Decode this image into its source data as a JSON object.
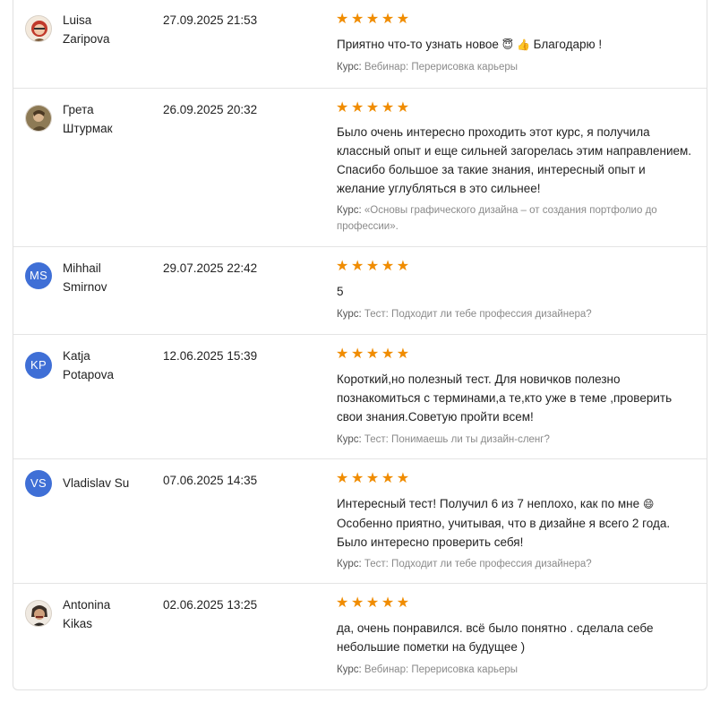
{
  "reviews": [
    {
      "name_line1": "Luisa",
      "name_line2": "Zaripova",
      "avatar_type": "photo",
      "avatar_icon": "user-photo-icon",
      "date": "27.09.2025 21:53",
      "stars": "★★★★★",
      "rating": 5,
      "text_before": "Приятно что-то узнать новое ",
      "text_after": " Благодарю !",
      "emoji_1": "😇",
      "emoji_2": "👍",
      "course_label": "Курс:",
      "course": "Вебинар: Перерисовка карьеры"
    },
    {
      "name_line1": "Грета",
      "name_line2": "Штурмак",
      "avatar_type": "photo",
      "avatar_icon": "user-photo-icon",
      "date": "26.09.2025 20:32",
      "stars": "★★★★★",
      "rating": 5,
      "text": "Было очень интересно проходить этот курс, я получила классный опыт и еще сильней загорелась этим направлением. Спасибо большое за такие знания, интересный опыт и желание углубляться в это сильнее!",
      "course_label": "Курс:",
      "course": "«Основы графического дизайна – от создания портфолио до профессии»."
    },
    {
      "name_line1": "Mihhail",
      "name_line2": "Smirnov",
      "avatar_type": "initials",
      "initials": "MS",
      "date": "29.07.2025 22:42",
      "stars": "★★★★★",
      "rating": 5,
      "text": "5",
      "course_label": "Курс:",
      "course": "Тест: Подходит ли тебе профессия дизайнера?"
    },
    {
      "name_line1": "Katja",
      "name_line2": "Potapova",
      "avatar_type": "initials",
      "initials": "KP",
      "date": "12.06.2025 15:39",
      "stars": "★★★★★",
      "rating": 5,
      "text": "Короткий,но полезный тест. Для новичков полезно познакомиться с терминами,а те,кто уже в теме ,проверить свои знания.Советую пройти всем!",
      "course_label": "Курс:",
      "course": "Тест: Понимаешь ли ты дизайн-сленг?"
    },
    {
      "name_line1": "Vladislav Su",
      "name_line2": "",
      "avatar_type": "initials",
      "initials": "VS",
      "date": "07.06.2025 14:35",
      "stars": "★★★★★",
      "rating": 5,
      "text_line1": "Интересный тест! Получил 6 из 7 неплохо, как по мне ",
      "emoji_1": "😄",
      "text_rest": "Особенно приятно, учитывая, что в дизайне я всего 2 года. Было интересно проверить себя!",
      "course_label": "Курс:",
      "course": "Тест: Подходит ли тебе профессия дизайнера?"
    },
    {
      "name_line1": "Antonina",
      "name_line2": "Kikas",
      "avatar_type": "photo",
      "avatar_icon": "user-photo-icon",
      "date": "02.06.2025 13:25",
      "stars": "★★★★★",
      "rating": 5,
      "text": "да, очень понравился. всё было понятно . сделала себе небольшие пометки на будущее )",
      "course_label": "Курс:",
      "course": "Вебинар: Перерисовка карьеры"
    }
  ],
  "colors": {
    "star": "#f08c00",
    "avatar_initials_bg": "#3f6fd6",
    "muted": "#8a8a8a",
    "border": "#e4e4e4"
  }
}
